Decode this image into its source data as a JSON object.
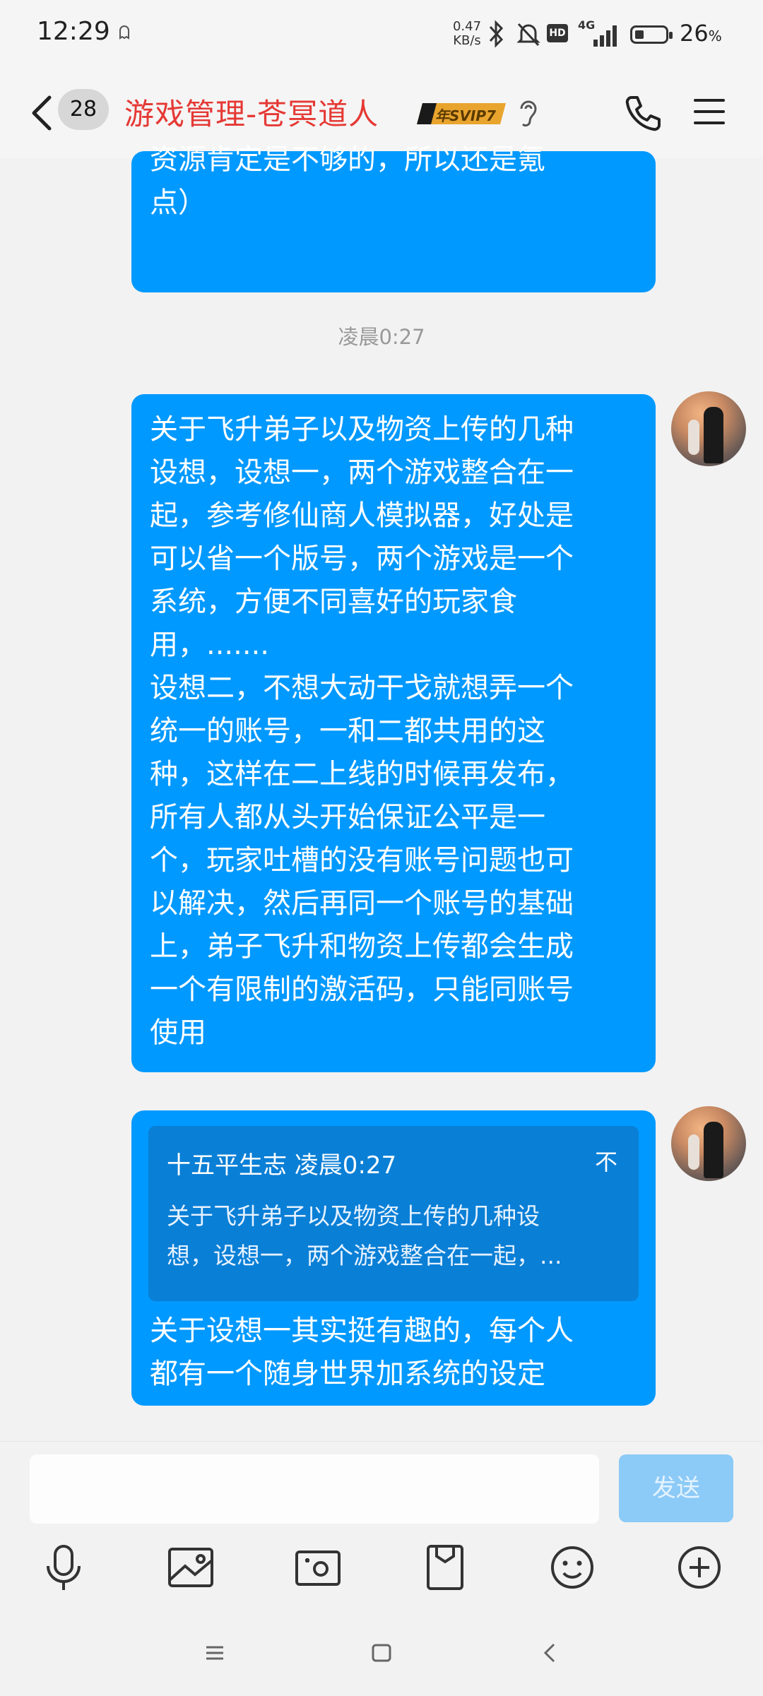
{
  "status_bar": {
    "time": "12:29",
    "net_speed_value": "0.47",
    "net_speed_unit": "KB/s",
    "network": "4G",
    "hd_label": "HD",
    "battery_percent": "26",
    "battery_unit": "%"
  },
  "header": {
    "unread_count": "28",
    "title": "游戏管理-苍冥道人",
    "vip_badge": "年SVIP7"
  },
  "messages": [
    {
      "text_lines": [
        "资源肯定是不够的，所以还是氪",
        "点）"
      ]
    },
    {
      "timestamp": "凌晨0:27"
    },
    {
      "text_lines": [
        "关于飞升弟子以及物资上传的几种",
        "设想，设想一，两个游戏整合在一",
        "起，参考修仙商人模拟器，好处是",
        "可以省一个版号，两个游戏是一个",
        "系统，方便不同喜好的玩家食",
        "用，.......",
        "设想二，不想大动干戈就想弄一个",
        "统一的账号，一和二都共用的这",
        "种，这样在二上线的时候再发布，",
        "所有人都从头开始保证公平是一",
        "个，玩家吐槽的没有账号问题也可",
        "以解决，然后再同一个账号的基础",
        "上，弟子飞升和物资上传都会生成",
        "一个有限制的激活码，只能同账号",
        "使用"
      ]
    },
    {
      "quote": {
        "author": "十五平生志",
        "time": "凌晨0:27",
        "mark": "不",
        "preview_lines": [
          "关于飞升弟子以及物资上传的几种设",
          "想，设想一，两个游戏整合在一起，..."
        ]
      },
      "text_lines": [
        "关于设想一其实挺有趣的，每个人",
        "都有一个随身世界加系统的设定"
      ]
    }
  ],
  "input": {
    "value": "",
    "send_label": "发送"
  },
  "colors": {
    "bubble": "#0099ff",
    "title_red": "#e53935",
    "send_disabled": "#8ccaf7"
  },
  "toolbar_icons": [
    "microphone-icon",
    "image-icon",
    "camera-icon",
    "file-icon",
    "emoji-icon",
    "plus-icon"
  ],
  "nav_icons": [
    "menu-nav-icon",
    "home-nav-icon",
    "back-nav-icon"
  ]
}
